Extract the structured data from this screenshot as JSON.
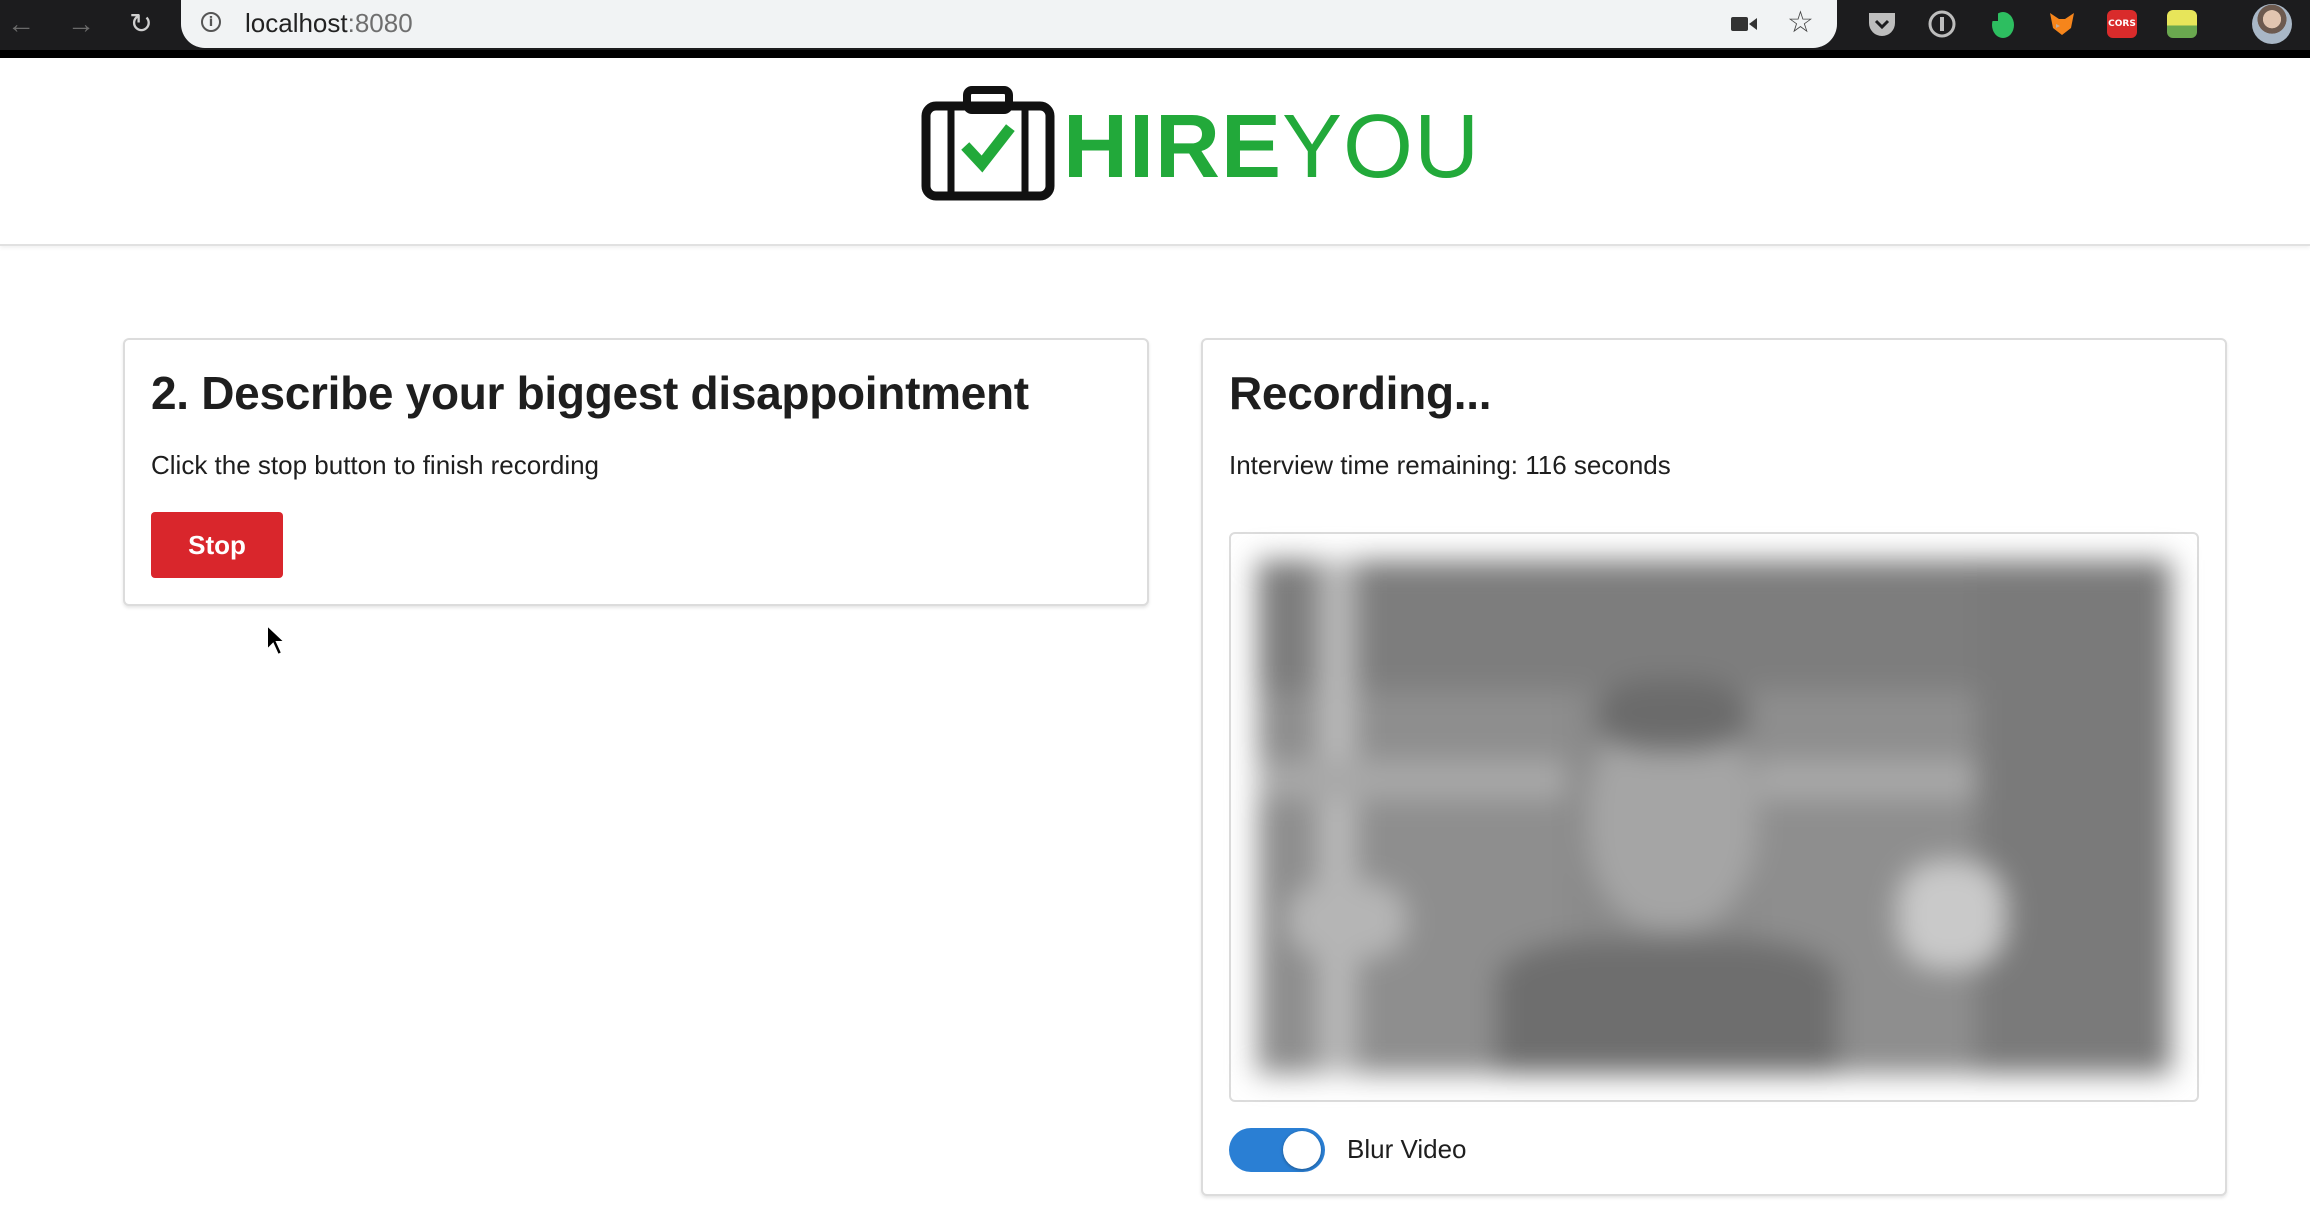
{
  "browser": {
    "url_host": "localhost",
    "url_port": ":8080",
    "icons": [
      "back-arrow-icon",
      "forward-arrow-icon",
      "reload-icon",
      "info-icon",
      "video-camera-icon",
      "star-icon",
      "pocket-icon",
      "onepassword-icon",
      "evernote-icon",
      "metamask-icon",
      "cors-icon",
      "extension-icon",
      "profile-avatar"
    ],
    "ext_cors_label": "CORS"
  },
  "header": {
    "logo_hire": "HIRE",
    "logo_you": "YOU",
    "brand_color": "#22a93a"
  },
  "question": {
    "title": "2. Describe your biggest disappointment",
    "instruction": "Click the stop button to finish recording",
    "stop_label": "Stop",
    "stop_color": "#d9262c"
  },
  "recording": {
    "title": "Recording...",
    "time_remaining": "Interview time remaining: 116 seconds",
    "blur_label": "Blur Video",
    "blur_enabled": true,
    "toggle_color": "#2a7fd4"
  }
}
